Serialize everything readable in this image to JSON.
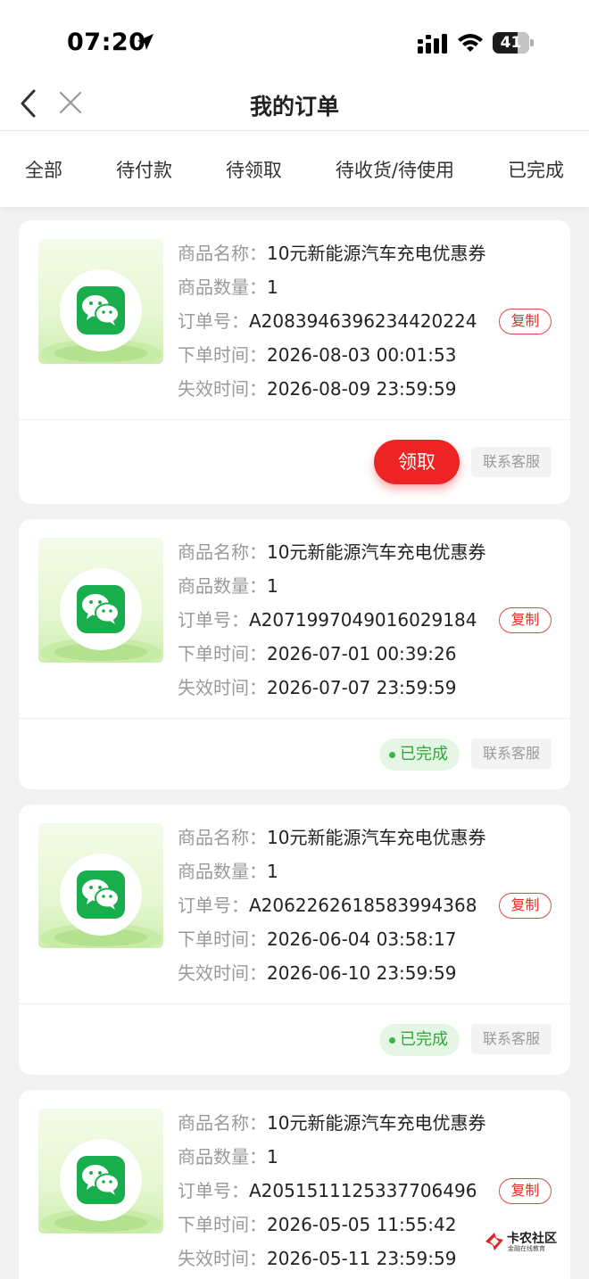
{
  "status_bar": {
    "time": "07:20",
    "battery": "41"
  },
  "nav": {
    "title": "我的订单"
  },
  "tabs": [
    "全部",
    "待付款",
    "待领取",
    "待收货/待使用",
    "已完成"
  ],
  "labels": {
    "name": "商品名称：",
    "qty": "商品数量：",
    "order_no": "订单号：",
    "order_time": "下单时间：",
    "expire_time": "失效时间：",
    "copy": "复制",
    "claim": "领取",
    "service": "联系客服",
    "completed": "已完成"
  },
  "orders": [
    {
      "name": "10元新能源汽车充电优惠券",
      "qty": "1",
      "order_no": "A2083946396234420224",
      "order_time": "2026-08-03 00:01:53",
      "expire_time": "2026-08-09 23:59:59",
      "status": "待领取"
    },
    {
      "name": "10元新能源汽车充电优惠券",
      "qty": "1",
      "order_no": "A2071997049016029184",
      "order_time": "2026-07-01 00:39:26",
      "expire_time": "2026-07-07 23:59:59",
      "status": "已完成"
    },
    {
      "name": "10元新能源汽车充电优惠券",
      "qty": "1",
      "order_no": "A2062262618583994368",
      "order_time": "2026-06-04 03:58:17",
      "expire_time": "2026-06-10 23:59:59",
      "status": "已完成"
    },
    {
      "name": "10元新能源汽车充电优惠券",
      "qty": "1",
      "order_no": "A2051511125337706496",
      "order_time": "2026-05-05 11:55:42",
      "expire_time": "2026-05-11 23:59:59",
      "status": ""
    }
  ],
  "watermark": {
    "title": "卡农社区",
    "subtitle": "金融在线教育"
  },
  "colors": {
    "accent_red": "#ee2424",
    "success_green": "#2fa83a",
    "wechat_green": "#1aad4e"
  }
}
